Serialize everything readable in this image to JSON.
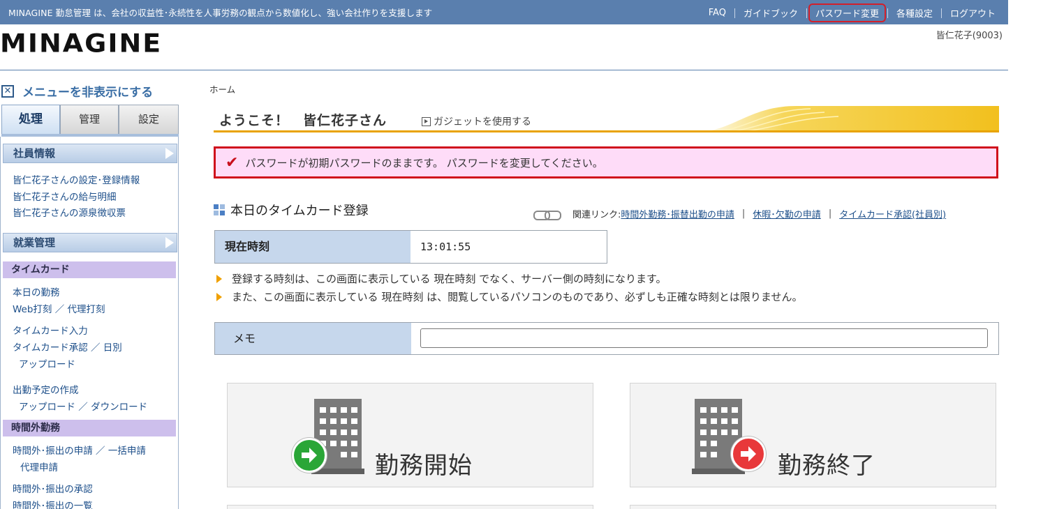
{
  "topbar": {
    "tagline": "MINAGINE 勤怠管理 は、会社の収益性･永続性を人事労務の観点から数値化し、強い会社作りを支援します",
    "links": [
      "FAQ",
      "ガイドブック",
      "パスワード変更",
      "各種設定",
      "ログアウト"
    ]
  },
  "brand": {
    "logo": "MINAGINE",
    "user": "皆仁花子(9003)"
  },
  "sidebar": {
    "hide_menu": "メニューを非表示にする",
    "tabs": [
      "処理",
      "管理",
      "設定"
    ],
    "sections": {
      "employee": {
        "title": "社員情報",
        "links": [
          "皆仁花子さんの設定･登録情報",
          "皆仁花子さんの給与明細",
          "皆仁花子さんの源泉徴収票"
        ]
      },
      "work": {
        "title": "就業管理"
      },
      "timecard": {
        "title": "タイムカード",
        "links": [
          "本日の勤務",
          "Web打刻 ／ 代理打刻",
          "タイムカード入力",
          "タイムカード承認 ／ 日別",
          "アップロード",
          "出勤予定の作成",
          "アップロード ／ ダウンロード"
        ]
      },
      "overtime": {
        "title": "時間外勤務",
        "links": [
          "時間外･振出の申請 ／ 一括申請",
          "代理申請",
          "時間外･振出の承認",
          "時間外･振出の一覧"
        ]
      }
    }
  },
  "main": {
    "breadcrumb": "ホーム",
    "welcome": "ようこそ！　皆仁花子さん",
    "gadget": "ガジェットを使用する",
    "alert": "パスワードが初期パスワードのままです。 パスワードを変更してください。",
    "timecard_title": "本日のタイムカード登録",
    "related_label": "関連リンク:",
    "related_links": [
      "時間外勤務･振替出勤の申請",
      "休暇･欠勤の申請",
      "タイムカード承認(社員別)"
    ],
    "current_time_label": "現在時刻",
    "current_time": "13:01:55",
    "notes": [
      "登録する時刻は、この画面に表示している 現在時刻 でなく、サーバー側の時刻になります。",
      "また、この画面に表示している 現在時刻 は、閲覧しているパソコンのものであり、必ずしも正確な時刻とは限りません。"
    ],
    "memo_label": "メモ",
    "memo_value": "",
    "start_button": "勤務開始",
    "end_button": "勤務終了"
  },
  "colors": {
    "topbar": "#5a7fae",
    "alert_border": "#d0101c",
    "alert_bg": "#fedcf8",
    "accent_orange": "#e9a300",
    "start_green": "#2aa637",
    "end_red": "#e8383a"
  }
}
